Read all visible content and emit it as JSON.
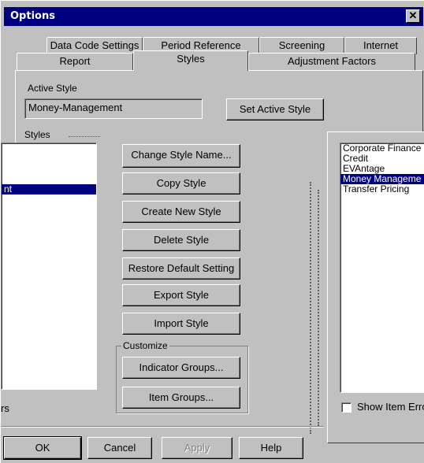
{
  "window": {
    "title": "Options",
    "close_glyph": "✕"
  },
  "tabs_back_row": [
    "Data Code Settings",
    "Period Reference",
    "Screening",
    "Internet"
  ],
  "tabs_front_row": [
    "Report",
    "Styles",
    "Adjustment Factors"
  ],
  "active_tab": "Styles",
  "active_style": {
    "label": "Active Style",
    "value": "Money-Management",
    "set_button": "Set Active Style"
  },
  "styles_label": "Styles",
  "left_list": {
    "items": [
      "nt"
    ],
    "selected_index": 0
  },
  "buttons": {
    "change_style_name": "Change Style Name...",
    "copy_style": "Copy Style",
    "create_new_style": "Create New Style",
    "delete_style": "Delete Style",
    "restore_default": "Restore Default Setting",
    "export_style": "Export Style",
    "import_style": "Import Style"
  },
  "customize": {
    "label": "Customize",
    "indicator_groups": "Indicator Groups...",
    "item_groups": "Item Groups..."
  },
  "right_list": {
    "items": [
      "Corporate Finance",
      "Credit",
      "EVAntage",
      "Money Manageme",
      "Transfer Pricing"
    ],
    "selected_index": 3
  },
  "show_item_error": {
    "label": "Show Item Erro",
    "checked": false
  },
  "left_partial_label": "rs",
  "footer": {
    "ok": "OK",
    "cancel": "Cancel",
    "apply": "Apply",
    "help": "Help"
  }
}
